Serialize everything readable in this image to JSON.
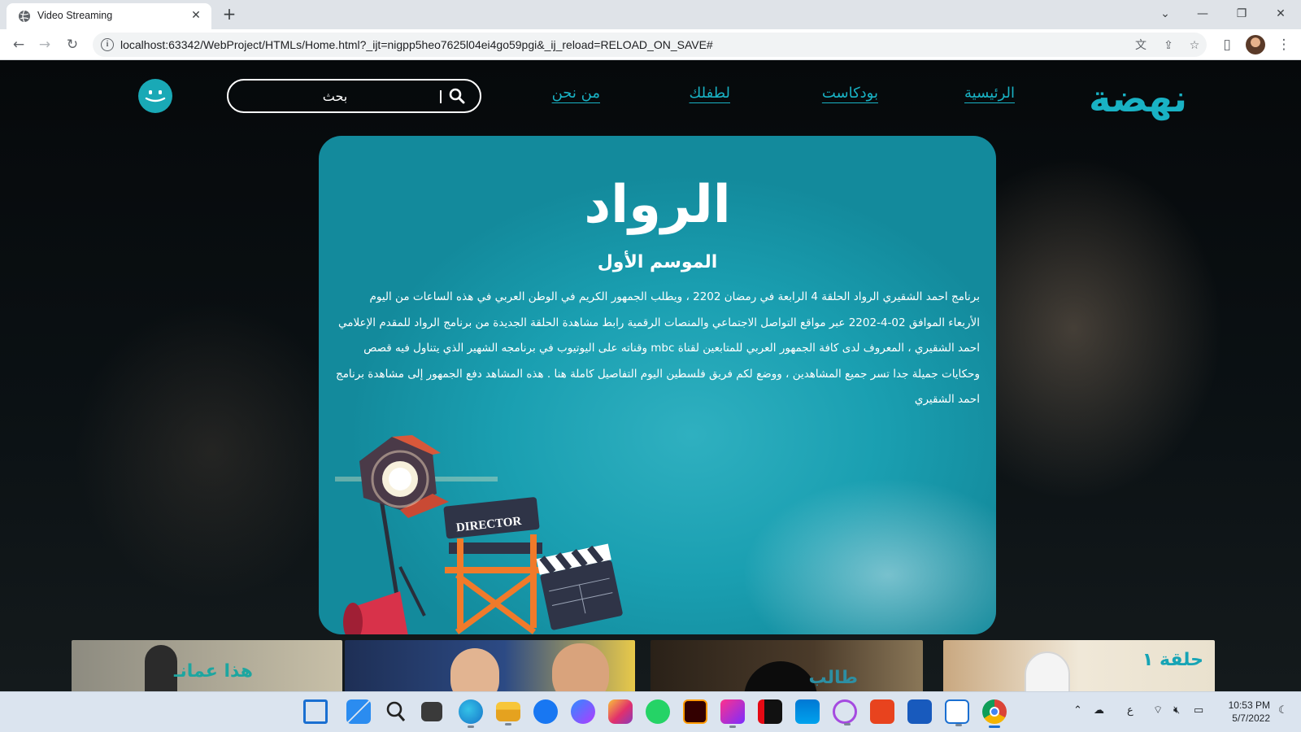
{
  "browser": {
    "tab_title": "Video Streaming",
    "url": "localhost:63342/WebProject/HTMLs/Home.html?_ijt=nigpp5heo7625l04ei4go59pgi&_ij_reload=RELOAD_ON_SAVE#"
  },
  "site": {
    "logo": "نهضة",
    "nav": [
      {
        "label": "الرئيسية"
      },
      {
        "label": "بودكاست"
      },
      {
        "label": "لطفلك"
      },
      {
        "label": "من نحن"
      }
    ],
    "search_placeholder": "بحث"
  },
  "hero": {
    "title": "الرواد",
    "season": "الموسم الأول",
    "description": "برنامج احمد الشقيري الرواد الحلقة 4 الرابعة في رمضان 2202 ، ويطلب الجمهور الكريم في الوطن العربي في هذه الساعات من اليوم الأربعاء الموافق 02-4-2202 عبر مواقع التواصل الاجتماعي والمنصات الرقمية رابط مشاهدة الحلقة الجديدة من برنامج الرواد للمقدم الإعلامي احمد الشقيري ، المعروف لدى كافة الجمهور العربي للمتابعين لقناة mbc وقناته على اليوتيوب في برنامجه الشهير الذي يتناول فيه قصص وحكايات جميلة جدا تسر جميع المشاهدين ، ووضع لكم فريق فلسطين اليوم التفاصيل كاملة هنا . هذه المشاهد دفع الجمهور إلى مشاهدة برنامج احمد الشقيري",
    "illustration_label": "DIRECTOR"
  },
  "thumbnails": [
    {
      "label": "هذا عمانـ"
    },
    {
      "label": ""
    },
    {
      "label": "طالب"
    },
    {
      "label": "حلقة ١"
    }
  ],
  "taskbar": {
    "clock_time": "10:53 PM",
    "clock_date": "5/7/2022",
    "lang": "ع"
  },
  "colors": {
    "accent": "#19b2c4",
    "hero_bg": "#1a9fb1"
  }
}
